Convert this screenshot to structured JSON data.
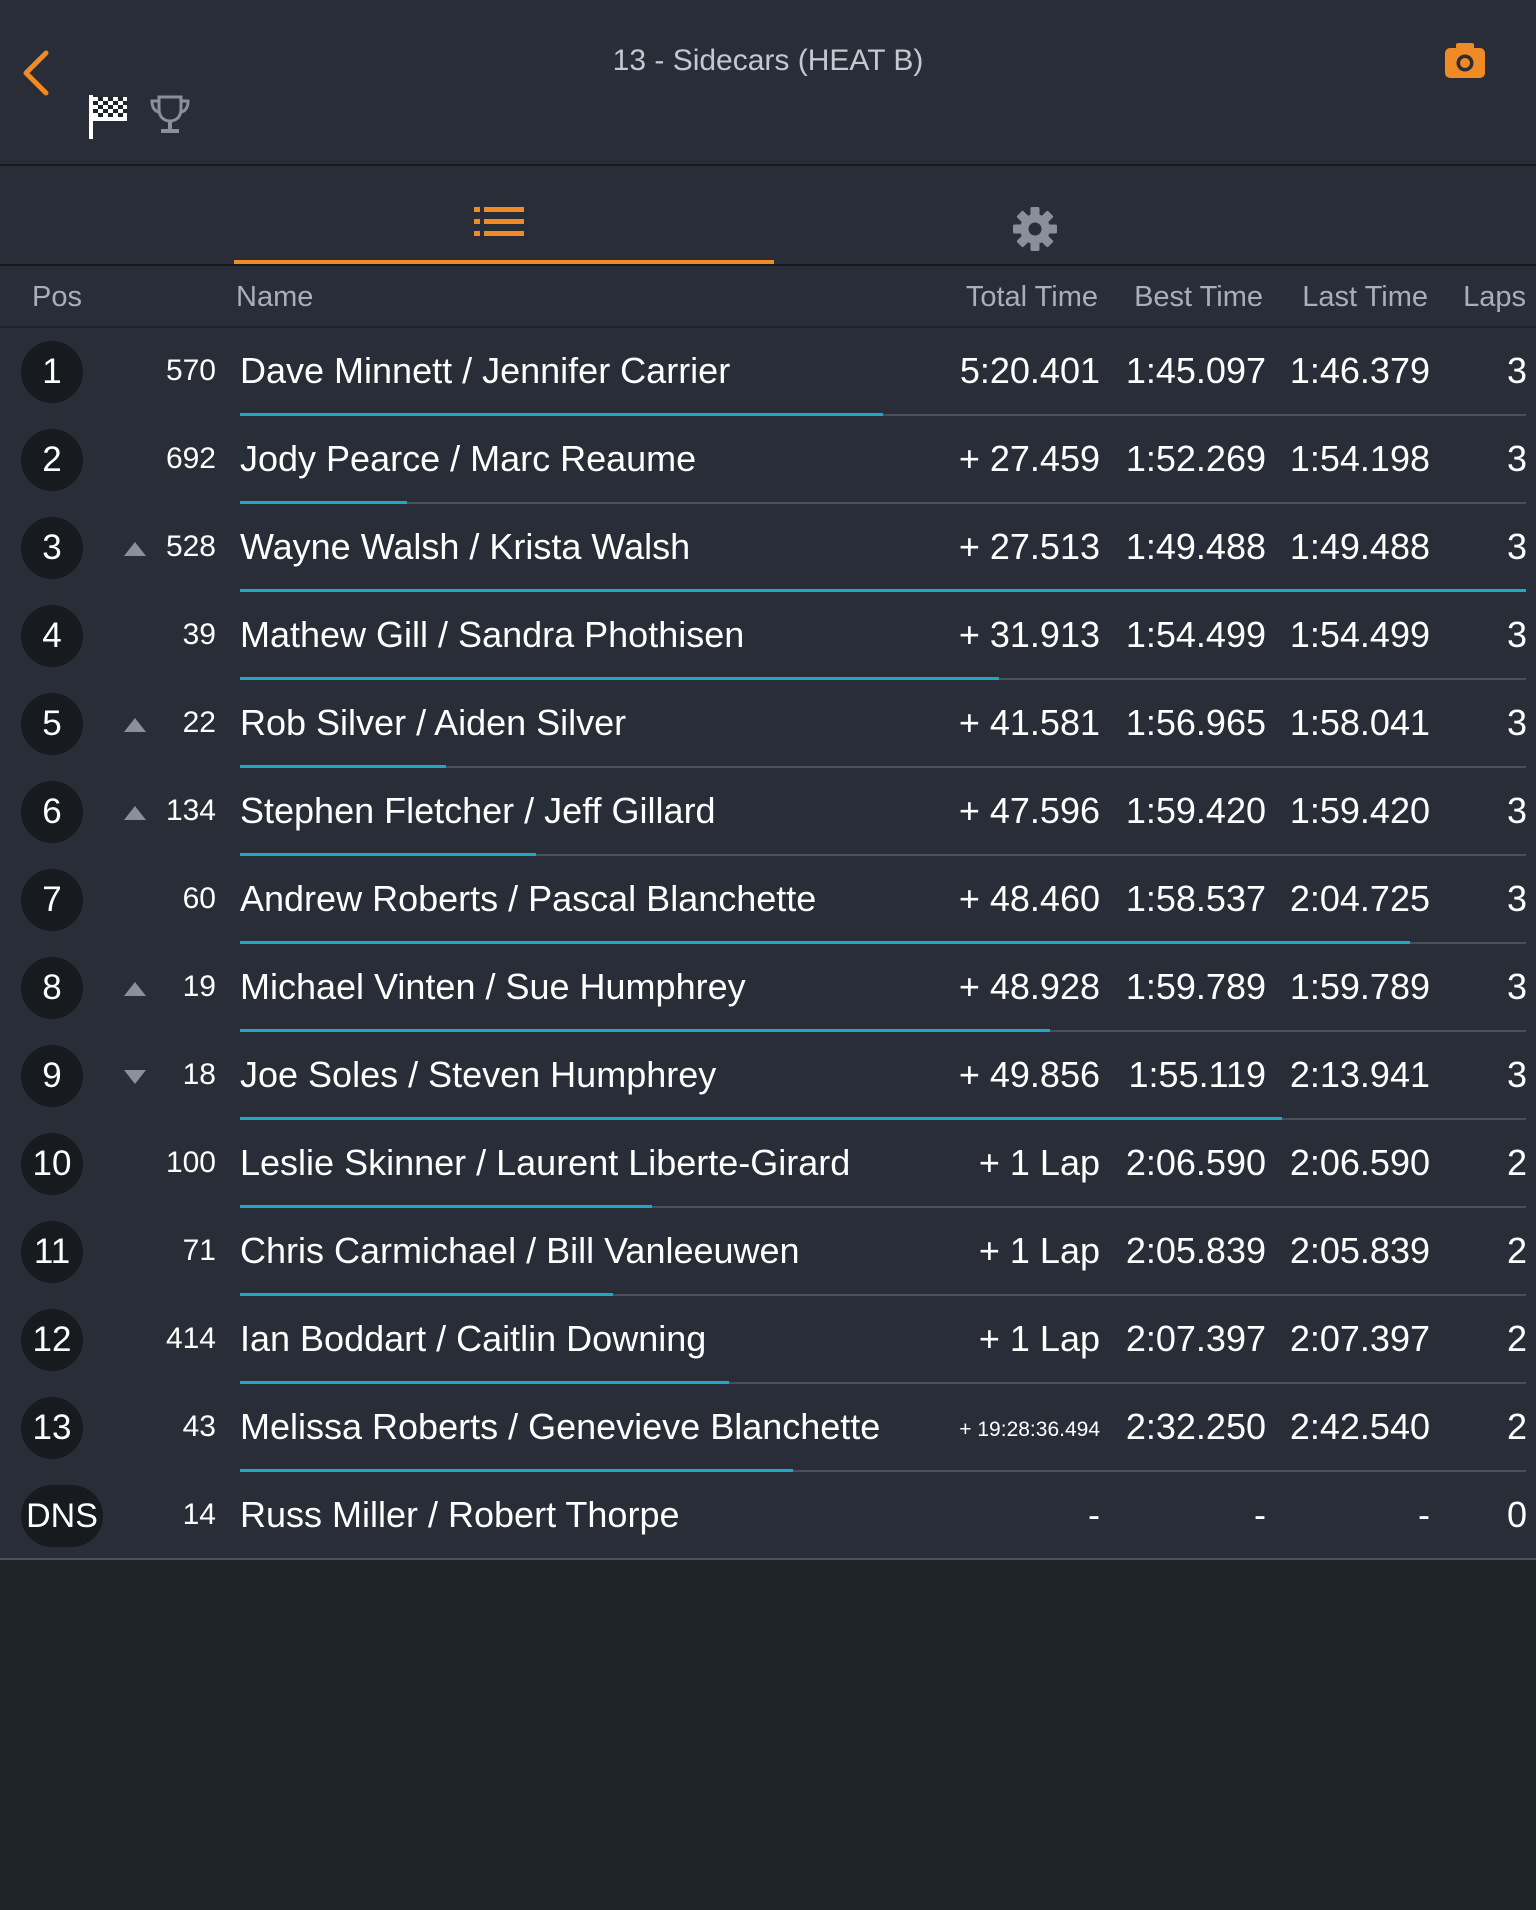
{
  "header": {
    "title": "13 - Sidecars (HEAT B)",
    "icons": [
      "back-chevron-icon",
      "checkered-flag-icon",
      "trophy-icon",
      "camera-icon"
    ]
  },
  "tabs": [
    {
      "icon": "list-icon",
      "active": true
    },
    {
      "icon": "gear-icon",
      "active": false
    }
  ],
  "columns": {
    "pos": "Pos",
    "name": "Name",
    "total": "Total Time",
    "best": "Best Time",
    "last": "Last Time",
    "laps": "Laps"
  },
  "colors": {
    "accent": "#f08a24",
    "progress": "#1ea7c9",
    "background": "#1f232a",
    "panel": "#282d37"
  },
  "rows": [
    {
      "pos": "1",
      "trend": "",
      "number": "570",
      "name": "Dave Minnett /  Jennifer Carrier",
      "total": "5:20.401",
      "best": "1:45.097",
      "last": "1:46.379",
      "laps": "3",
      "progress": 0.5
    },
    {
      "pos": "2",
      "trend": "",
      "number": "692",
      "name": "Jody Pearce /  Marc Reaume",
      "total": "+ 27.459",
      "best": "1:52.269",
      "last": "1:54.198",
      "laps": "3",
      "progress": 0.13
    },
    {
      "pos": "3",
      "trend": "up",
      "number": "528",
      "name": "Wayne Walsh /  Krista Walsh",
      "total": "+ 27.513",
      "best": "1:49.488",
      "last": "1:49.488",
      "laps": "3",
      "progress": 1.0
    },
    {
      "pos": "4",
      "trend": "",
      "number": "39",
      "name": "Mathew Gill /  Sandra Phothisen",
      "total": "+ 31.913",
      "best": "1:54.499",
      "last": "1:54.499",
      "laps": "3",
      "progress": 0.59
    },
    {
      "pos": "5",
      "trend": "up",
      "number": "22",
      "name": "Rob Silver /  Aiden Silver",
      "total": "+ 41.581",
      "best": "1:56.965",
      "last": "1:58.041",
      "laps": "3",
      "progress": 0.16
    },
    {
      "pos": "6",
      "trend": "up",
      "number": "134",
      "name": "Stephen Fletcher /  Jeff Gillard",
      "total": "+ 47.596",
      "best": "1:59.420",
      "last": "1:59.420",
      "laps": "3",
      "progress": 0.23
    },
    {
      "pos": "7",
      "trend": "",
      "number": "60",
      "name": "Andrew Roberts /  Pascal Blanchette",
      "total": "+ 48.460",
      "best": "1:58.537",
      "last": "2:04.725",
      "laps": "3",
      "progress": 0.91
    },
    {
      "pos": "8",
      "trend": "up",
      "number": "19",
      "name": "Michael Vinten /  Sue Humphrey",
      "total": "+ 48.928",
      "best": "1:59.789",
      "last": "1:59.789",
      "laps": "3",
      "progress": 0.63
    },
    {
      "pos": "9",
      "trend": "down",
      "number": "18",
      "name": "Joe Soles /  Steven Humphrey",
      "total": "+ 49.856",
      "best": "1:55.119",
      "last": "2:13.941",
      "laps": "3",
      "progress": 0.81
    },
    {
      "pos": "10",
      "trend": "",
      "number": "100",
      "name": "Leslie Skinner /  Laurent Liberte-Girard",
      "total": "+ 1 Lap",
      "best": "2:06.590",
      "last": "2:06.590",
      "laps": "2",
      "progress": 0.32
    },
    {
      "pos": "11",
      "trend": "",
      "number": "71",
      "name": "Chris Carmichael /  Bill Vanleeuwen",
      "total": "+ 1 Lap",
      "best": "2:05.839",
      "last": "2:05.839",
      "laps": "2",
      "progress": 0.29
    },
    {
      "pos": "12",
      "trend": "",
      "number": "414",
      "name": "Ian Boddart /  Caitlin Downing",
      "total": "+ 1 Lap",
      "best": "2:07.397",
      "last": "2:07.397",
      "laps": "2",
      "progress": 0.38
    },
    {
      "pos": "13",
      "trend": "",
      "number": "43",
      "name": "Melissa Roberts /  Genevieve Blanchette",
      "total": "+ 19:28:36.494",
      "best": "2:32.250",
      "last": "2:42.540",
      "laps": "2",
      "progress": 0.43
    },
    {
      "pos": "DNS",
      "trend": "",
      "number": "14",
      "name": "Russ Miller /  Robert Thorpe",
      "total": "-",
      "best": "-",
      "last": "-",
      "laps": "0",
      "progress": 0
    }
  ]
}
